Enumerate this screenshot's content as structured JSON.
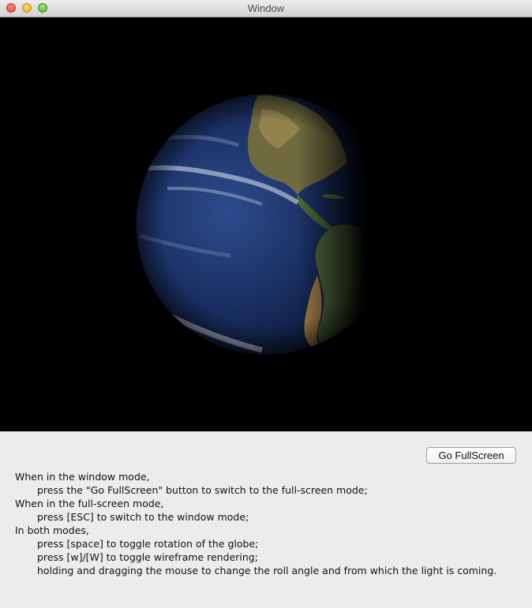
{
  "window": {
    "title": "Window"
  },
  "titlebar_buttons": {
    "close_icon": "close-icon",
    "minimize_icon": "minimize-icon",
    "zoom_icon": "zoom-icon"
  },
  "viewport": {
    "content": "earth-globe"
  },
  "controls": {
    "fullscreen_label": "Go FullScreen"
  },
  "instructions": [
    {
      "text": "When in the window mode,",
      "indent": false
    },
    {
      "text": "press the \"Go FullScreen\" button to switch to the full-screen mode;",
      "indent": true
    },
    {
      "text": "When in the full-screen mode,",
      "indent": false
    },
    {
      "text": "press [ESC] to switch to the window mode;",
      "indent": true
    },
    {
      "text": "In both modes,",
      "indent": false
    },
    {
      "text": "press [space] to toggle rotation of the globe;",
      "indent": true
    },
    {
      "text": "press [w]/[W] to toggle wireframe rendering;",
      "indent": true
    },
    {
      "text": "holding and dragging the mouse to change the roll angle and from which the light is coming.",
      "indent": true
    }
  ]
}
